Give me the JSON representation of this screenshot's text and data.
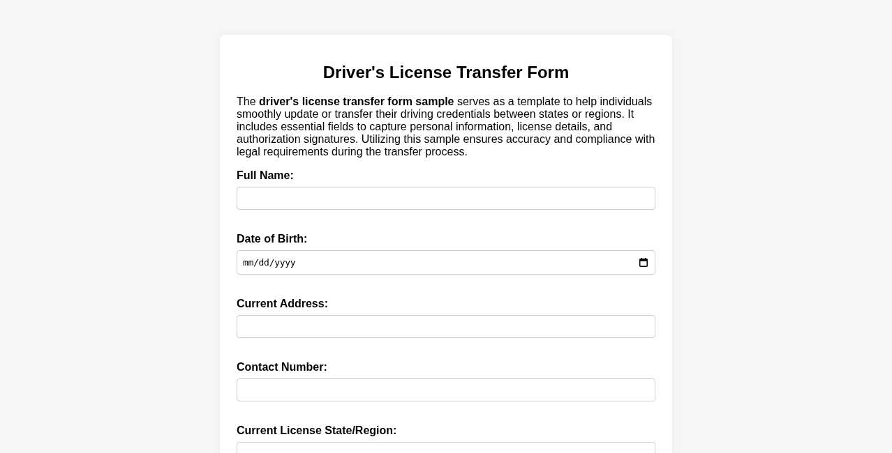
{
  "title": "Driver's License Transfer Form",
  "intro": "The **driver's license transfer form sample** serves as a template to help individuals smoothly update or transfer their driving credentials between states or regions. It includes essential fields to capture personal information, license details, and authorization signatures. Utilizing this sample ensures accuracy and compliance with legal requirements during the transfer process.",
  "fields": [
    {
      "kind": "text",
      "label": "Full Name:"
    },
    {
      "kind": "date",
      "label": "Date of Birth:",
      "placeholder": "mm/dd/yyyy"
    },
    {
      "kind": "text",
      "label": "Current Address:"
    },
    {
      "kind": "text",
      "label": "Contact Number:"
    },
    {
      "kind": "text",
      "label": "Current License State/Region:"
    }
  ]
}
